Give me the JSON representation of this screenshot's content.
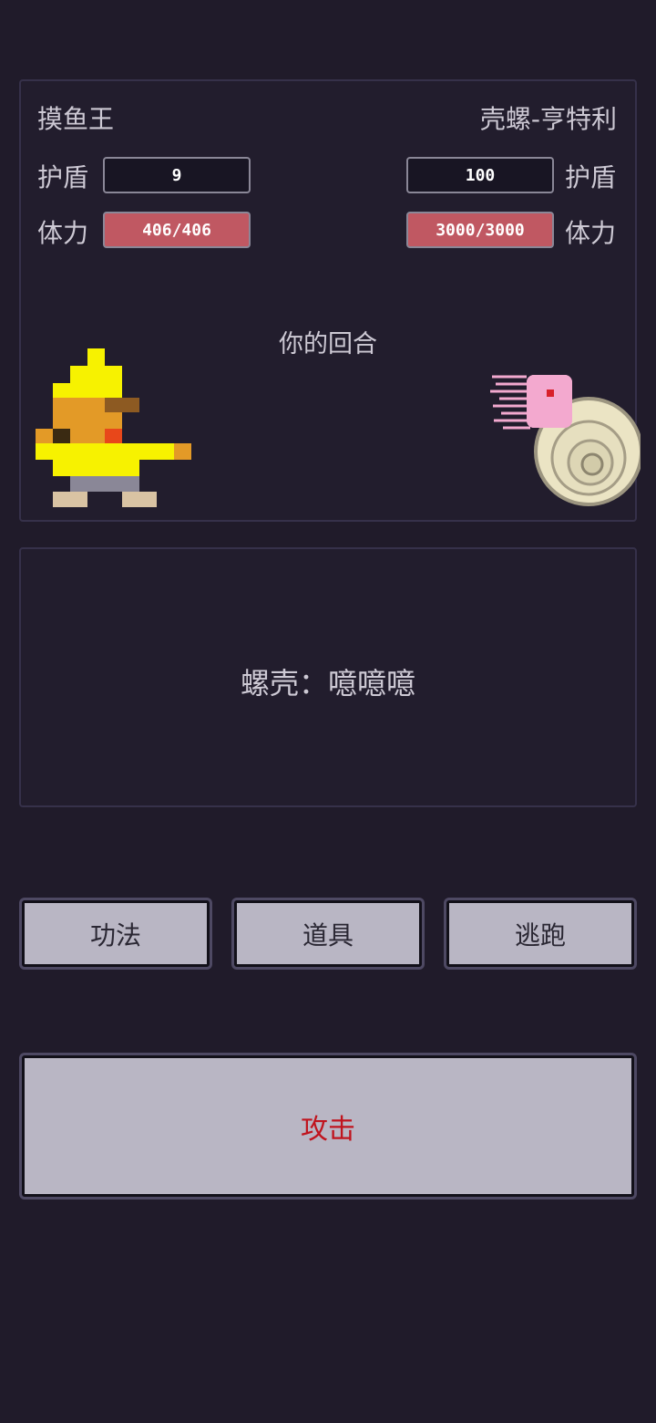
{
  "player": {
    "name": "摸鱼王",
    "shield_label": "护盾",
    "shield_value": "9",
    "hp_label": "体力",
    "hp_value": "406/406",
    "hp_fraction": 1.0
  },
  "enemy": {
    "name": "壳螺-亨特利",
    "shield_label": "护盾",
    "shield_value": "100",
    "hp_label": "体力",
    "hp_value": "3000/3000",
    "hp_fraction": 1.0
  },
  "battle": {
    "turn_text": "你的回合"
  },
  "log": {
    "message": "螺壳：噫噫噫"
  },
  "actions": {
    "skill_label": "功法",
    "item_label": "道具",
    "flee_label": "逃跑",
    "attack_label": "攻击"
  },
  "colors": {
    "background": "#201b2a",
    "hp_bar": "#c05862",
    "button": "#b9b6c4",
    "attack_text": "#c0141e"
  },
  "icons": {
    "player_sprite": "yellow-pixel-hero-icon",
    "enemy_sprite": "ammonite-squid-icon"
  }
}
